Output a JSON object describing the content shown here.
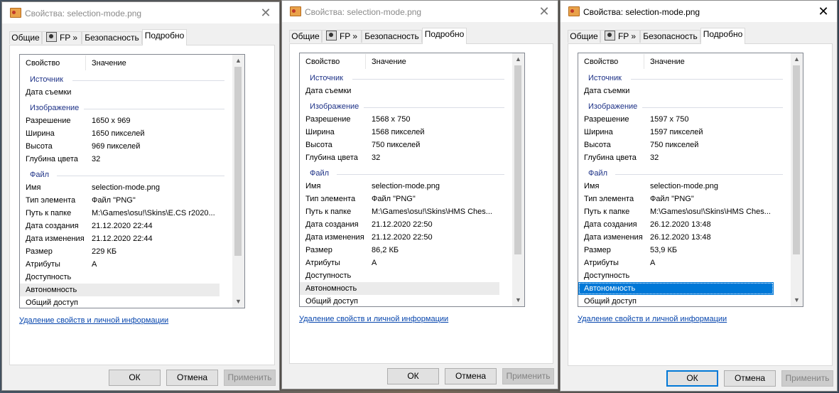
{
  "tabs": [
    "Общие",
    "FP »",
    "Безопасность",
    "Подробно"
  ],
  "columns": {
    "property": "Свойство",
    "value": "Значение"
  },
  "groups": {
    "source": "Источник",
    "image": "Изображение",
    "file": "Файл"
  },
  "labels": {
    "date_taken": "Дата съемки",
    "resolution": "Разрешение",
    "width": "Ширина",
    "height": "Высота",
    "bit_depth": "Глубина цвета",
    "name": "Имя",
    "item_type": "Тип элемента",
    "folder_path": "Путь к папке",
    "date_created": "Дата создания",
    "date_modified": "Дата изменения",
    "size": "Размер",
    "attributes": "Атрибуты",
    "availability": "Доступность",
    "offline_status": "Автономность",
    "shared": "Общий доступ"
  },
  "link_text": "Удаление свойств и личной информации",
  "buttons": {
    "ok": "ОК",
    "cancel": "Отмена",
    "apply": "Применить"
  },
  "close_glyph": "✕",
  "scroll_up_glyph": "▲",
  "scroll_down_glyph": "▼",
  "dialogs": [
    {
      "title": "Свойства: selection-mode.png",
      "active": false,
      "values": {
        "date_taken": "",
        "resolution": "1650 x 969",
        "width": "1650 пикселей",
        "height": "969 пикселей",
        "bit_depth": "32",
        "name": "selection-mode.png",
        "item_type": "Файл \"PNG\"",
        "folder_path": "M:\\Games\\osu!\\Skins\\E.CS r2020...",
        "date_created": "21.12.2020 22:44",
        "date_modified": "21.12.2020 22:44",
        "size": "229 КБ",
        "attributes": "A",
        "availability": "",
        "offline_status": "",
        "shared": ""
      }
    },
    {
      "title": "Свойства: selection-mode.png",
      "active": false,
      "values": {
        "date_taken": "",
        "resolution": "1568 x 750",
        "width": "1568 пикселей",
        "height": "750 пикселей",
        "bit_depth": "32",
        "name": "selection-mode.png",
        "item_type": "Файл \"PNG\"",
        "folder_path": "M:\\Games\\osu!\\Skins\\HMS Ches...",
        "date_created": "21.12.2020 22:50",
        "date_modified": "21.12.2020 22:50",
        "size": "86,2 КБ",
        "attributes": "A",
        "availability": "",
        "offline_status": "",
        "shared": ""
      }
    },
    {
      "title": "Свойства: selection-mode.png",
      "active": true,
      "values": {
        "date_taken": "",
        "resolution": "1597 x 750",
        "width": "1597 пикселей",
        "height": "750 пикселей",
        "bit_depth": "32",
        "name": "selection-mode.png",
        "item_type": "Файл \"PNG\"",
        "folder_path": "M:\\Games\\osu!\\Skins\\HMS Ches...",
        "date_created": "26.12.2020 13:48",
        "date_modified": "26.12.2020 13:48",
        "size": "53,9 КБ",
        "attributes": "A",
        "availability": "",
        "offline_status": "",
        "shared": ""
      }
    }
  ]
}
